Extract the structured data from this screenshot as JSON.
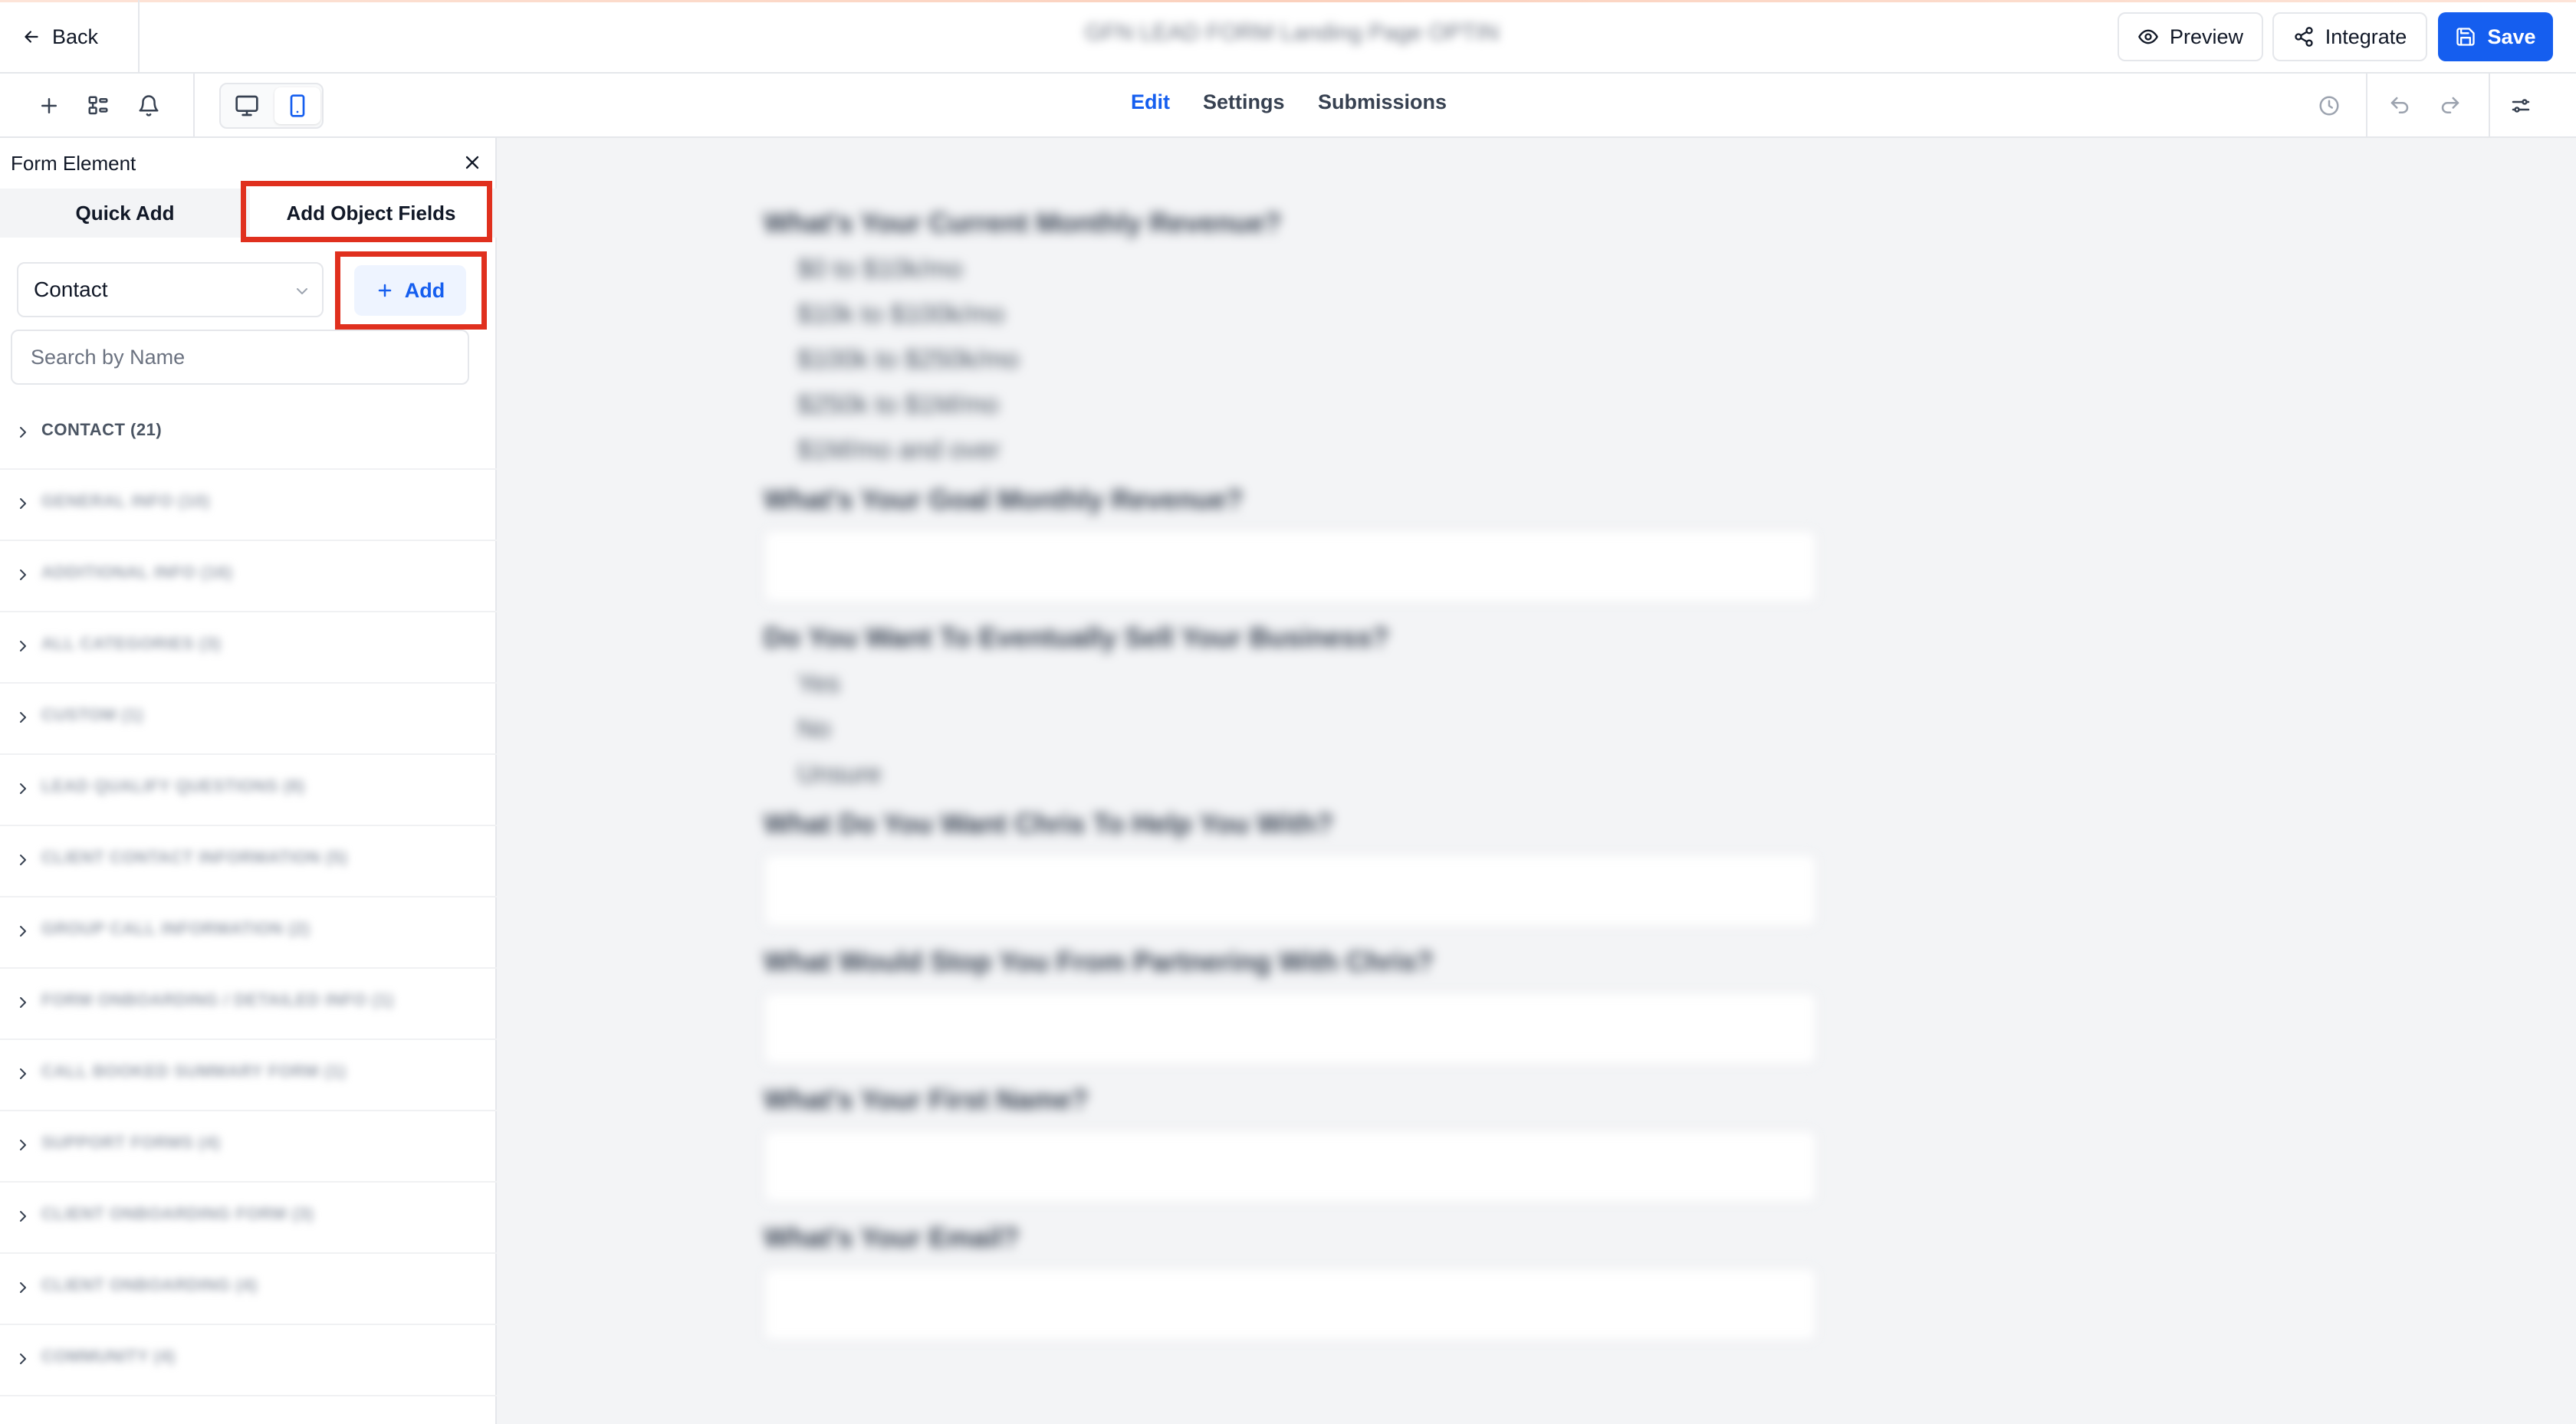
{
  "topbar": {
    "back_label": "Back",
    "page_title": "GFN LEAD FORM Landing Page OPTIN",
    "preview_label": "Preview",
    "integrate_label": "Integrate",
    "save_label": "Save",
    "accent_color": "#155eef"
  },
  "toolbar": {
    "tabs": [
      {
        "label": "Edit",
        "active": true
      },
      {
        "label": "Settings",
        "active": false
      },
      {
        "label": "Submissions",
        "active": false
      }
    ],
    "left_icons": [
      "plus-icon",
      "layers-icon",
      "bell-icon"
    ],
    "device_buttons": [
      "desktop-icon",
      "mobile-icon"
    ],
    "right_icons": [
      "history-icon",
      "undo-icon",
      "redo-icon",
      "sliders-icon"
    ]
  },
  "panel": {
    "title": "Form Element",
    "tabs": [
      {
        "label": "Quick Add",
        "active": false
      },
      {
        "label": "Add Object Fields",
        "active": true
      }
    ],
    "object_select_value": "Contact",
    "add_label": "Add",
    "search_placeholder": "Search by Name",
    "groups": [
      {
        "label": "CONTACT (21)",
        "blurred": false
      },
      {
        "label": "GENERAL INFO (10)",
        "blurred": true
      },
      {
        "label": "ADDITIONAL INFO (16)",
        "blurred": true
      },
      {
        "label": "ALL CATEGORIES (3)",
        "blurred": true
      },
      {
        "label": "CUSTOM (1)",
        "blurred": true
      },
      {
        "label": "LEAD QUALIFY QUESTIONS (8)",
        "blurred": true
      },
      {
        "label": "CLIENT CONTACT INFORMATION (5)",
        "blurred": true
      },
      {
        "label": "GROUP CALL INFORMATION (2)",
        "blurred": true
      },
      {
        "label": "FORM ONBOARDING / DETAILED INFO (1)",
        "blurred": true
      },
      {
        "label": "CALL BOOKED SUMMARY FORM (1)",
        "blurred": true
      },
      {
        "label": "SUPPORT FORMS (4)",
        "blurred": true
      },
      {
        "label": "CLIENT ONBOARDING FORM (3)",
        "blurred": true
      },
      {
        "label": "CLIENT ONBOARDING (4)",
        "blurred": true
      },
      {
        "label": "COMMUNITY (4)",
        "blurred": true
      }
    ]
  },
  "form_preview": {
    "q1": "What's Your Current Monthly Revenue?",
    "q1_options": [
      "$0 to $10k/mo",
      "$10k to $100k/mo",
      "$100k to $250k/mo",
      "$250k to $1M/mo",
      "$1M/mo and over"
    ],
    "q2": "What's Your Goal Monthly Revenue?",
    "q3": "Do You Want To Eventually Sell Your Business?",
    "q3_options": [
      "Yes",
      "No",
      "Unsure"
    ],
    "q4": "What Do You Want Chris To Help You With?",
    "q5": "What Would Stop You From Partnering With Chris?",
    "q6": "What's Your First Name?",
    "q7": "What's Your Email?"
  }
}
